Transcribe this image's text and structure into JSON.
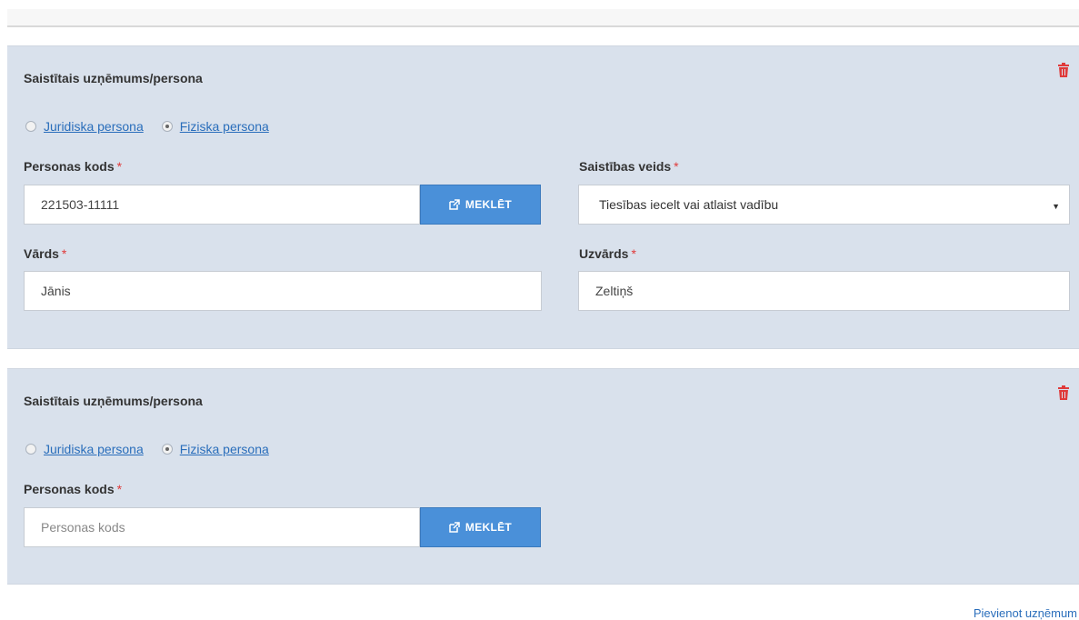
{
  "panels": [
    {
      "title": "Saistītais uzņēmums/persona",
      "radio_options": [
        {
          "label": "Juridiska persona",
          "checked": false
        },
        {
          "label": "Fiziska persona",
          "checked": true
        }
      ],
      "personas_kods": {
        "label": "Personas kods",
        "value": "221503-11111",
        "placeholder": ""
      },
      "search_button": "MEKLĒT",
      "saistibas_veids": {
        "label": "Saistības veids",
        "value": "Tiesības iecelt vai atlaist vadību"
      },
      "vards": {
        "label": "Vārds",
        "value": "Jānis"
      },
      "uzvards": {
        "label": "Uzvārds",
        "value": "Zeltiņš"
      }
    },
    {
      "title": "Saistītais uzņēmums/persona",
      "radio_options": [
        {
          "label": "Juridiska persona",
          "checked": false
        },
        {
          "label": "Fiziska persona",
          "checked": true
        }
      ],
      "personas_kods": {
        "label": "Personas kods",
        "value": "",
        "placeholder": "Personas kods"
      },
      "search_button": "MEKLĒT"
    }
  ],
  "required_marker": "*",
  "add_link": "Pievienot uzņēmum",
  "colors": {
    "panel_bg": "#d9e1ec",
    "button_bg": "#4a90d9",
    "link": "#2a6ebb",
    "required": "#e03a3a",
    "trash": "#e03a3a"
  },
  "icons": {
    "delete": "trash-icon",
    "search_button": "external-link-icon",
    "dropdown": "caret-down-icon"
  }
}
